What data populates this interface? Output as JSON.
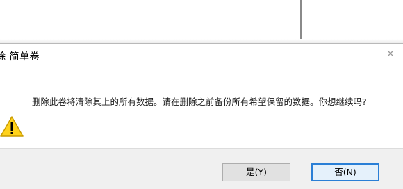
{
  "dialog": {
    "title": "除 简单卷",
    "message": "删除此卷将清除其上的所有数据。请在删除之前备份所有希望保留的数据。你想继续吗?",
    "close_glyph": "×",
    "icon": "warning-icon",
    "buttons": {
      "yes_label": "是",
      "yes_mnemonic": "(Y)",
      "no_label": "否",
      "no_mnemonic": "(N)"
    }
  },
  "colors": {
    "warning_fill": "#ffd21c",
    "warning_outline": "#c89a00",
    "default_button_border": "#2a7fd6",
    "footer_background": "#f0f0f0"
  }
}
